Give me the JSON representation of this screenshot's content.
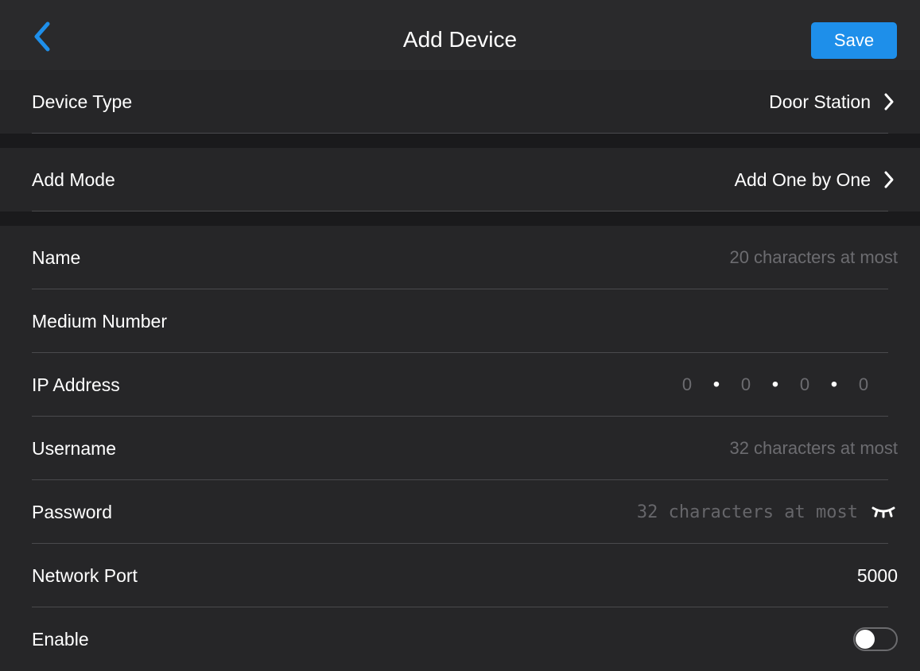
{
  "header": {
    "title": "Add Device",
    "save_label": "Save"
  },
  "device_type": {
    "label": "Device Type",
    "value": "Door Station"
  },
  "add_mode": {
    "label": "Add Mode",
    "value": "Add One by One"
  },
  "fields": {
    "name": {
      "label": "Name",
      "placeholder": "20 characters at most"
    },
    "medium_number": {
      "label": "Medium Number",
      "value": ""
    },
    "ip_address": {
      "label": "IP Address",
      "octets": [
        "0",
        "0",
        "0",
        "0"
      ]
    },
    "username": {
      "label": "Username",
      "placeholder": "32 characters at most"
    },
    "password": {
      "label": "Password",
      "placeholder": "32 characters at most"
    },
    "network_port": {
      "label": "Network Port",
      "value": "5000"
    },
    "enable": {
      "label": "Enable",
      "state": "off"
    }
  },
  "colors": {
    "accent": "#1e8fea",
    "background": "#1f1f21",
    "row_background": "#262628",
    "placeholder": "#6c6c70"
  },
  "icons": {
    "back": "chevron-left-icon",
    "row_arrow": "chevron-right-icon",
    "password_toggle": "eye-closed-icon"
  }
}
